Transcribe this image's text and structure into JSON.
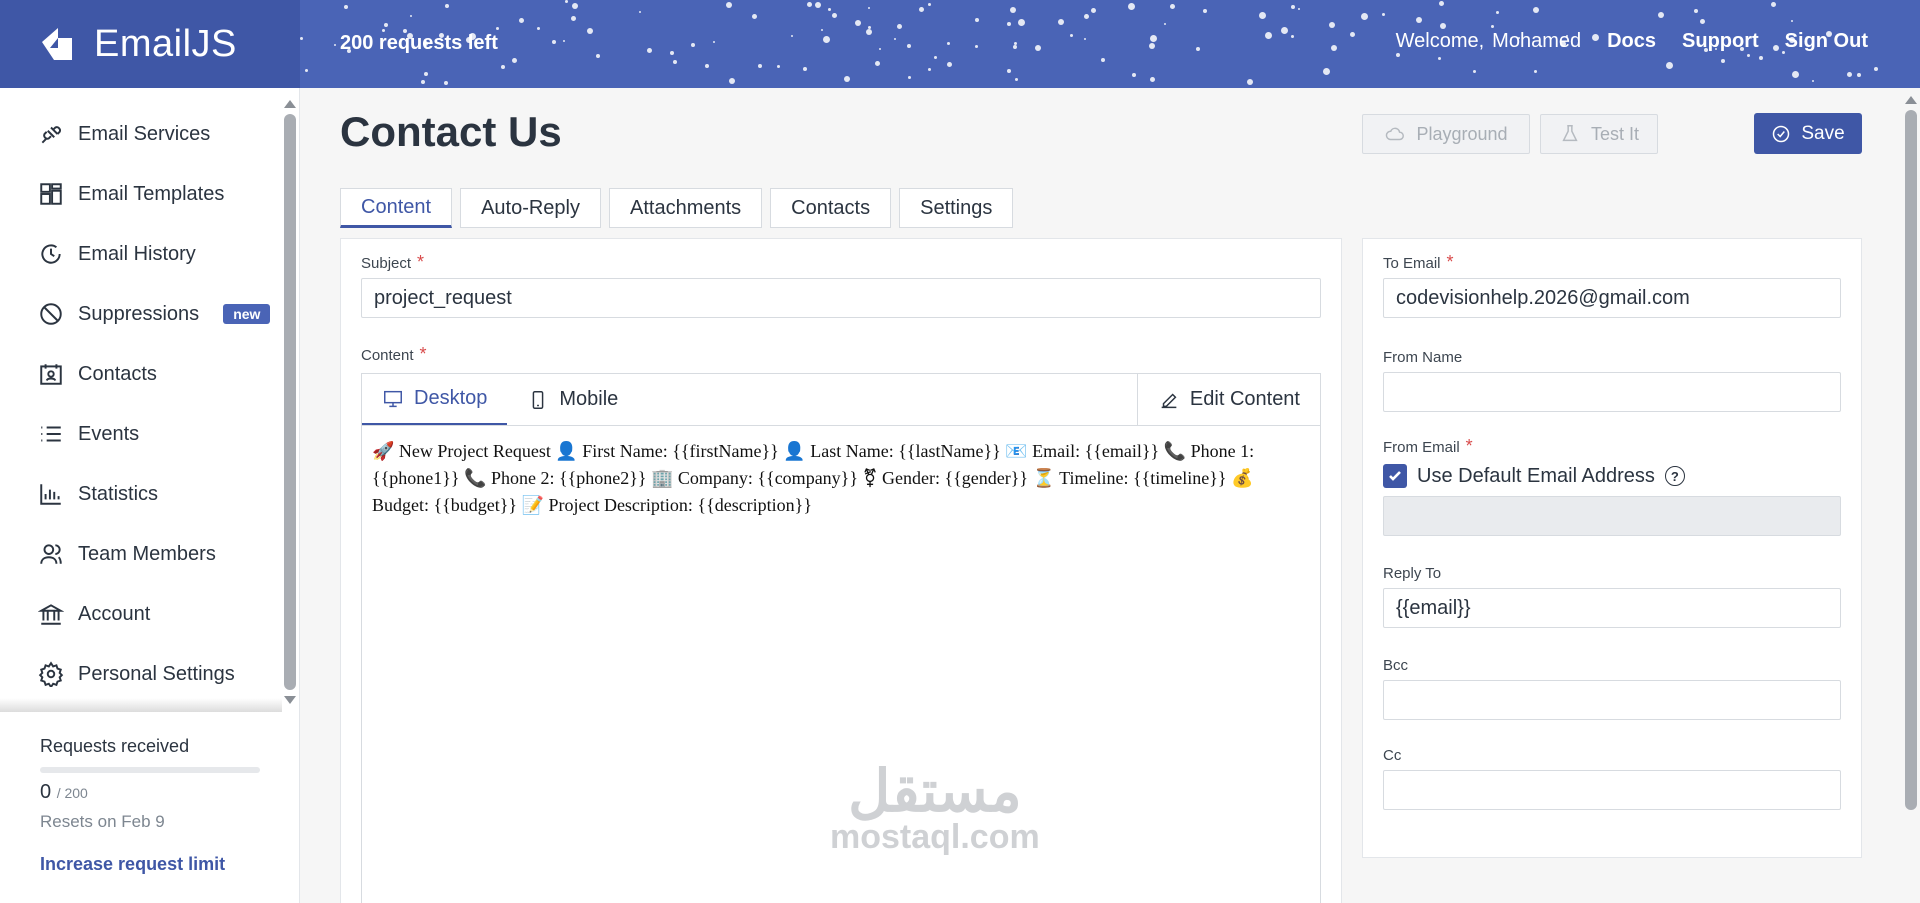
{
  "header": {
    "brand": "EmailJS",
    "requests_left": "200 requests left",
    "welcome": "Welcome,",
    "user": "Mohamed",
    "links": [
      "Docs",
      "Support",
      "Sign Out"
    ]
  },
  "sidebar": {
    "items": [
      {
        "label": "Email Services",
        "icon": "plug-icon"
      },
      {
        "label": "Email Templates",
        "icon": "templates-icon"
      },
      {
        "label": "Email History",
        "icon": "history-icon"
      },
      {
        "label": "Suppressions",
        "icon": "block-icon",
        "badge": "new"
      },
      {
        "label": "Contacts",
        "icon": "contacts-icon"
      },
      {
        "label": "Events",
        "icon": "list-icon"
      },
      {
        "label": "Statistics",
        "icon": "chart-icon"
      },
      {
        "label": "Team Members",
        "icon": "team-icon"
      },
      {
        "label": "Account",
        "icon": "bank-icon"
      },
      {
        "label": "Personal Settings",
        "icon": "gear-icon"
      }
    ],
    "usage": {
      "title": "Requests received",
      "count": "0",
      "max": "/ 200",
      "fraction": 0,
      "reset": "Resets on Feb 9",
      "link": "Increase request limit"
    }
  },
  "main": {
    "title": "Contact Us",
    "buttons": {
      "playground": "Playground",
      "test": "Test It",
      "save": "Save"
    },
    "tabs": [
      "Content",
      "Auto-Reply",
      "Attachments",
      "Contacts",
      "Settings"
    ],
    "subject_label": "Subject",
    "subject_value": "project_request",
    "content_label": "Content",
    "editor_tabs": {
      "desktop": "Desktop",
      "mobile": "Mobile",
      "edit": "Edit Content"
    },
    "content_body": "🚀 New Project Request 👤 First Name: {{firstName}} 👤 Last Name: {{lastName}} 📧 Email: {{email}} 📞 Phone 1: {{phone1}} 📞 Phone 2: {{phone2}} 🏢 Company: {{company}} ⚧ Gender: {{gender}} ⏳ Timeline: {{timeline}} 💰 Budget: {{budget}} 📝 Project Description: {{description}}",
    "watermark_ar": "مستقل",
    "watermark_en": "mostaql.com"
  },
  "right_panel": {
    "to_email_label": "To Email",
    "to_email_value": "codevisionhelp.2026@gmail.com",
    "from_name_label": "From Name",
    "from_name_value": "",
    "from_email_label": "From Email",
    "use_default_label": "Use Default Email Address",
    "use_default_checked": true,
    "reply_to_label": "Reply To",
    "reply_to_value": "{{email}}",
    "bcc_label": "Bcc",
    "bcc_value": "",
    "cc_label": "Cc",
    "cc_value": ""
  },
  "colors": {
    "brand": "#4a64b6",
    "brand_dark": "#3f57a6",
    "required": "#d84b4b"
  }
}
